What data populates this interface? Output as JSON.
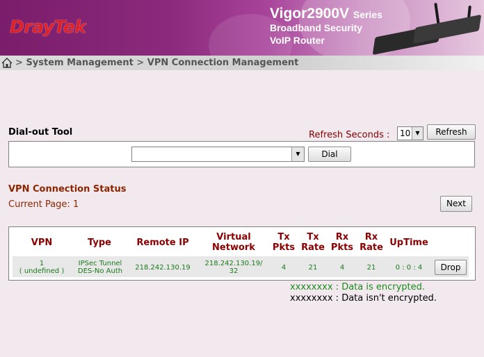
{
  "brand": {
    "logo": "DrayTek",
    "model": "Vigor2900V",
    "series": "Series",
    "tagline1": "Broadband Security",
    "tagline2": "VoIP Router"
  },
  "breadcrumb": {
    "sep": ">",
    "items": [
      "System Management",
      "VPN Connection Management"
    ]
  },
  "dialout": {
    "title": "Dial-out Tool",
    "refresh_label": "Refresh Seconds :",
    "refresh_value": "10",
    "refresh_button": "Refresh",
    "profile_value": "",
    "dial_button": "Dial"
  },
  "status": {
    "title": "VPN Connection Status",
    "current_page_label": "Current Page:",
    "current_page": "1",
    "next_button": "Next"
  },
  "table": {
    "headers": {
      "vpn": "VPN",
      "type": "Type",
      "remote_ip": "Remote IP",
      "virtual_network": [
        "Virtual",
        "Network"
      ],
      "tx_pkts": [
        "Tx",
        "Pkts"
      ],
      "tx_rate": [
        "Tx",
        "Rate"
      ],
      "rx_pkts": [
        "Rx",
        "Pkts"
      ],
      "rx_rate": [
        "Rx",
        "Rate"
      ],
      "uptime": "UpTime"
    },
    "rows": [
      {
        "vpn": [
          "1",
          "( undefined )"
        ],
        "type": [
          "IPSec Tunnel",
          "DES-No Auth"
        ],
        "remote_ip": "218.242.130.19",
        "virtual_network": [
          "218.242.130.19/",
          "32"
        ],
        "tx_pkts": "4",
        "tx_rate": "21",
        "rx_pkts": "4",
        "rx_rate": "21",
        "uptime": "0 : 0 : 4",
        "action": "Drop"
      }
    ]
  },
  "legend": {
    "encrypted": "xxxxxxxx : Data is encrypted.",
    "not_encrypted": "xxxxxxxx : Data isn't encrypted."
  },
  "colors": {
    "accent_red": "#8b0000",
    "encrypted_green": "#1a8a1a",
    "banner_purple": "#8b2a7c"
  }
}
